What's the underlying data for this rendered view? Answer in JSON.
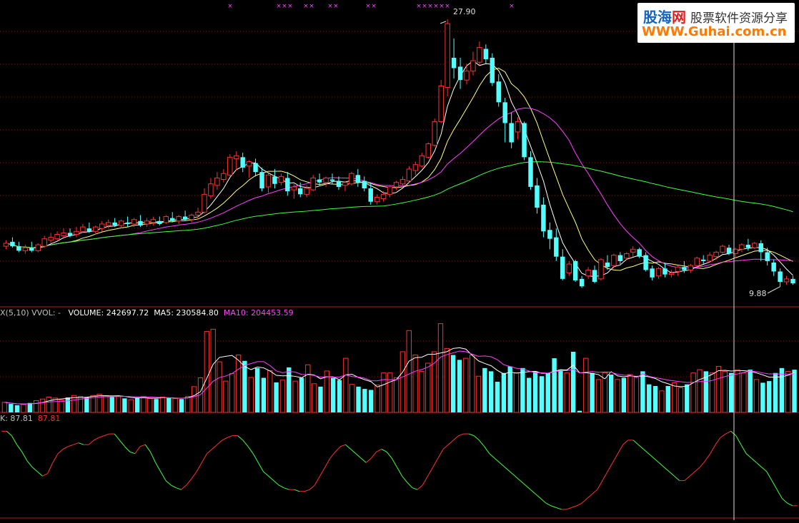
{
  "watermark": {
    "brand_a": "股海",
    "brand_b": "网",
    "tagline": "股票软件资源分享",
    "url": "WWW.Guhai.com.cn"
  },
  "price_panel": {
    "high_label": "27.90",
    "low_label": "9.88"
  },
  "volume_panel": {
    "legend": [
      {
        "text": "X(5,10)  VVOL: -",
        "color": "#c0c0c0"
      },
      {
        "text": "VOLUME: 242697.72",
        "color": "#ffffff"
      },
      {
        "text": "MA5: 230584.80",
        "color": "#ffffff"
      },
      {
        "text": "MA10: 204453.59",
        "color": "#ff40ff"
      }
    ]
  },
  "indicator_panel": {
    "legend": [
      {
        "text": "K: 87.81",
        "color": "#c0c0c0"
      },
      {
        "text": "87.81",
        "color": "#ff3030"
      }
    ]
  },
  "colors": {
    "up": "#ff3030",
    "down": "#54ffff",
    "ma5": "#ffffff",
    "ma10": "#ffff80",
    "ma20": "#ff40ff",
    "ma60": "#40ff40",
    "grid": "#7a1a1a"
  },
  "chart_data": [
    {
      "type": "candlestick",
      "title": "",
      "ylim": [
        9.0,
        29.0
      ],
      "markers": {
        "high": 27.9,
        "low": 9.88
      },
      "candles": [
        [
          12.6,
          13.0,
          12.8,
          12.4
        ],
        [
          12.9,
          13.2,
          12.6,
          12.5
        ],
        [
          12.6,
          12.9,
          12.3,
          12.2
        ],
        [
          12.3,
          12.7,
          12.5,
          12.1
        ],
        [
          12.5,
          12.9,
          12.3,
          12.2
        ],
        [
          12.3,
          12.8,
          12.7,
          12.2
        ],
        [
          12.6,
          13.3,
          13.1,
          12.5
        ],
        [
          13.0,
          13.5,
          13.2,
          12.8
        ],
        [
          13.1,
          13.6,
          13.4,
          13.0
        ],
        [
          13.3,
          13.8,
          13.5,
          13.1
        ],
        [
          13.5,
          13.8,
          13.3,
          13.2
        ],
        [
          13.4,
          13.9,
          13.6,
          13.2
        ],
        [
          13.6,
          14.1,
          13.9,
          13.5
        ],
        [
          13.8,
          14.2,
          13.6,
          13.5
        ],
        [
          13.6,
          14.0,
          13.9,
          13.4
        ],
        [
          13.8,
          14.3,
          14.1,
          13.6
        ],
        [
          14.0,
          14.4,
          14.2,
          13.8
        ],
        [
          14.2,
          14.5,
          14.0,
          13.9
        ],
        [
          14.0,
          14.4,
          14.3,
          13.8
        ],
        [
          14.2,
          14.6,
          14.1,
          13.9
        ],
        [
          14.1,
          14.5,
          14.4,
          13.9
        ],
        [
          14.3,
          14.7,
          14.0,
          13.9
        ],
        [
          14.1,
          14.5,
          14.3,
          13.9
        ],
        [
          14.2,
          14.6,
          14.4,
          14.0
        ],
        [
          14.3,
          14.6,
          14.1,
          14.0
        ],
        [
          14.2,
          14.7,
          14.6,
          14.1
        ],
        [
          14.5,
          14.9,
          14.3,
          14.2
        ],
        [
          14.3,
          14.7,
          14.6,
          14.1
        ],
        [
          14.6,
          15.0,
          14.4,
          14.3
        ],
        [
          14.4,
          14.8,
          14.7,
          14.2
        ],
        [
          14.7,
          15.2,
          14.9,
          14.4
        ],
        [
          14.9,
          16.5,
          16.1,
          14.8
        ],
        [
          16.0,
          17.2,
          16.8,
          15.8
        ],
        [
          16.7,
          17.6,
          17.2,
          16.4
        ],
        [
          17.1,
          17.8,
          17.5,
          16.9
        ],
        [
          17.4,
          18.8,
          18.6,
          17.3
        ],
        [
          18.5,
          19.0,
          18.7,
          17.7
        ],
        [
          18.6,
          18.9,
          17.9,
          17.6
        ],
        [
          18.0,
          18.4,
          18.3,
          17.2
        ],
        [
          18.2,
          18.5,
          17.6,
          17.3
        ],
        [
          17.6,
          17.9,
          16.5,
          16.3
        ],
        [
          16.6,
          17.5,
          17.4,
          16.2
        ],
        [
          17.3,
          17.8,
          16.8,
          16.5
        ],
        [
          16.9,
          17.5,
          17.3,
          16.7
        ],
        [
          17.2,
          17.6,
          16.3,
          16.0
        ],
        [
          16.4,
          16.8,
          16.6,
          15.8
        ],
        [
          16.5,
          16.9,
          16.1,
          15.9
        ],
        [
          16.1,
          16.7,
          16.5,
          15.9
        ],
        [
          16.4,
          17.4,
          17.2,
          16.3
        ],
        [
          17.1,
          17.5,
          16.9,
          16.7
        ],
        [
          16.9,
          17.3,
          17.2,
          16.6
        ],
        [
          17.1,
          17.5,
          17.0,
          16.8
        ],
        [
          17.0,
          17.3,
          16.6,
          16.4
        ],
        [
          16.7,
          17.0,
          16.9,
          16.3
        ],
        [
          16.8,
          17.6,
          17.5,
          16.7
        ],
        [
          17.4,
          17.8,
          16.9,
          16.6
        ],
        [
          17.0,
          17.3,
          16.5,
          16.3
        ],
        [
          16.5,
          16.9,
          15.6,
          15.4
        ],
        [
          15.6,
          16.1,
          15.9,
          15.4
        ],
        [
          15.8,
          16.3,
          16.1,
          15.6
        ],
        [
          16.1,
          16.7,
          16.6,
          15.9
        ],
        [
          16.6,
          17.0,
          16.9,
          16.4
        ],
        [
          16.8,
          17.3,
          17.1,
          16.6
        ],
        [
          17.0,
          18.0,
          17.8,
          16.9
        ],
        [
          17.7,
          18.3,
          18.1,
          17.4
        ],
        [
          18.0,
          18.9,
          18.7,
          17.9
        ],
        [
          18.6,
          19.6,
          19.5,
          18.5
        ],
        [
          19.4,
          21.2,
          21.0,
          19.3
        ],
        [
          21.0,
          23.8,
          23.4,
          20.9
        ],
        [
          23.3,
          27.9,
          27.6,
          22.7
        ],
        [
          25.3,
          26.6,
          24.6,
          23.9
        ],
        [
          24.7,
          25.3,
          23.8,
          23.2
        ],
        [
          23.8,
          24.9,
          24.4,
          23.5
        ],
        [
          24.4,
          25.7,
          25.1,
          24.1
        ],
        [
          25.0,
          26.4,
          26.0,
          24.8
        ],
        [
          25.9,
          26.2,
          25.2,
          24.9
        ],
        [
          25.3,
          25.6,
          23.6,
          23.4
        ],
        [
          23.7,
          24.2,
          22.3,
          22.0
        ],
        [
          22.3,
          22.6,
          20.9,
          19.6
        ],
        [
          20.9,
          21.6,
          19.6,
          19.2
        ],
        [
          20.3,
          21.3,
          21.0,
          19.8
        ],
        [
          20.9,
          21.0,
          18.6,
          18.4
        ],
        [
          18.6,
          19.0,
          16.6,
          16.4
        ],
        [
          16.7,
          17.2,
          15.2,
          14.8
        ],
        [
          15.4,
          15.9,
          13.6,
          13.2
        ],
        [
          13.7,
          14.2,
          13.1,
          12.4
        ],
        [
          13.2,
          13.8,
          11.9,
          11.6
        ],
        [
          11.9,
          12.4,
          10.4,
          10.3
        ],
        [
          10.8,
          11.6,
          11.4,
          10.6
        ],
        [
          11.6,
          11.7,
          10.3,
          10.2
        ],
        [
          10.4,
          10.6,
          9.9,
          9.8
        ],
        [
          10.6,
          11.2,
          11.0,
          10.4
        ],
        [
          11.0,
          11.3,
          10.2,
          10.1
        ],
        [
          10.4,
          11.8,
          11.7,
          10.3
        ],
        [
          11.5,
          12.0,
          11.2,
          11.0
        ],
        [
          11.3,
          12.1,
          12.0,
          11.1
        ],
        [
          12.0,
          12.2,
          11.6,
          11.4
        ],
        [
          11.8,
          12.2,
          12.1,
          11.7
        ],
        [
          12.2,
          12.6,
          12.4,
          11.9
        ],
        [
          12.4,
          12.5,
          11.9,
          11.8
        ],
        [
          12.0,
          12.2,
          11.0,
          10.9
        ],
        [
          11.1,
          11.3,
          10.5,
          10.3
        ],
        [
          10.6,
          11.2,
          11.1,
          10.4
        ],
        [
          11.1,
          11.5,
          10.7,
          10.5
        ],
        [
          10.7,
          11.0,
          10.8,
          10.5
        ],
        [
          10.9,
          11.3,
          11.2,
          10.6
        ],
        [
          11.2,
          11.6,
          11.0,
          10.8
        ],
        [
          11.0,
          11.4,
          11.3,
          10.8
        ],
        [
          11.3,
          11.9,
          11.8,
          11.2
        ],
        [
          11.7,
          12.0,
          11.6,
          11.4
        ],
        [
          11.6,
          12.2,
          12.0,
          11.5
        ],
        [
          11.9,
          12.3,
          12.2,
          11.7
        ],
        [
          12.2,
          12.7,
          12.6,
          12.1
        ],
        [
          12.5,
          12.7,
          12.1,
          12.0
        ],
        [
          12.1,
          12.5,
          12.4,
          11.8
        ],
        [
          12.4,
          12.8,
          12.7,
          12.2
        ],
        [
          12.7,
          13.1,
          12.5,
          12.3
        ],
        [
          12.5,
          12.9,
          12.8,
          12.4
        ],
        [
          12.8,
          13.0,
          12.2,
          11.6
        ],
        [
          12.2,
          12.5,
          11.6,
          11.3
        ],
        [
          11.5,
          11.7,
          10.9,
          10.6
        ],
        [
          10.9,
          11.1,
          10.2,
          9.88
        ],
        [
          10.2,
          10.6,
          10.4,
          10.0
        ],
        [
          10.4,
          10.6,
          10.1,
          10.0
        ]
      ]
    },
    {
      "type": "bar",
      "title": "",
      "series_name": "VOLUME",
      "ylim": [
        0,
        280000
      ],
      "values": [
        31000,
        26000,
        22000,
        24000,
        29000,
        36000,
        41000,
        47000,
        44000,
        38000,
        46000,
        52000,
        49000,
        47000,
        52000,
        56000,
        51000,
        47000,
        49000,
        43000,
        39000,
        45000,
        49000,
        43000,
        41000,
        47000,
        45000,
        43000,
        41000,
        49000,
        79000,
        106000,
        248000,
        255000,
        155000,
        96000,
        119000,
        176000,
        158000,
        107000,
        136000,
        106000,
        128000,
        92000,
        99000,
        138000,
        96000,
        106000,
        146000,
        88000,
        79000,
        127000,
        106000,
        99000,
        166000,
        86000,
        79000,
        72000,
        69000,
        84000,
        121000,
        121000,
        106000,
        186000,
        251000,
        176000,
        126000,
        151000,
        186000,
        272000,
        196000,
        176000,
        161000,
        166000,
        176000,
        111000,
        136000,
        126000,
        94000,
        121000,
        141000,
        121000,
        136000,
        106000,
        126000,
        111000,
        121000,
        166000,
        131000,
        121000,
        186000,
        5000,
        166000,
        121000,
        101000,
        121000,
        116000,
        101000,
        106000,
        116000,
        111000,
        126000,
        86000,
        81000,
        66000,
        81000,
        91000,
        76000,
        86000,
        121000,
        131000,
        126000,
        121000,
        141000,
        126000,
        121000,
        131000,
        121000,
        131000,
        101000,
        91000,
        96000,
        121000,
        136000,
        126000,
        131000
      ]
    },
    {
      "type": "line",
      "title": "",
      "series_name": "K",
      "ylim": [
        0,
        100
      ],
      "values": [
        95,
        95,
        90,
        80,
        72,
        62,
        55,
        50,
        45,
        48,
        60,
        70,
        75,
        78,
        80,
        82,
        80,
        80,
        85,
        88,
        90,
        92,
        92,
        85,
        78,
        72,
        70,
        78,
        80,
        72,
        60,
        50,
        40,
        35,
        32,
        30,
        35,
        42,
        50,
        60,
        70,
        75,
        80,
        85,
        88,
        90,
        90,
        85,
        78,
        70,
        60,
        50,
        45,
        40,
        35,
        32,
        30,
        30,
        28,
        28,
        30,
        35,
        45,
        55,
        65,
        72,
        78,
        80,
        75,
        70,
        65,
        60,
        65,
        72,
        75,
        72,
        65,
        55,
        45,
        38,
        32,
        30,
        35,
        45,
        55,
        65,
        75,
        80,
        85,
        90,
        92,
        92,
        90,
        85,
        78,
        70,
        65,
        60,
        55,
        50,
        45,
        40,
        35,
        30,
        25,
        20,
        15,
        12,
        10,
        8,
        8,
        10,
        12,
        15,
        20,
        25,
        30,
        40,
        50,
        60,
        70,
        80,
        85,
        85,
        80,
        75,
        70,
        65,
        60,
        55,
        50,
        45,
        40,
        40,
        45,
        50,
        55,
        62,
        70,
        80,
        88,
        92,
        95,
        90,
        80,
        70,
        65,
        60,
        55,
        50,
        40,
        30,
        20,
        15,
        12,
        12
      ]
    }
  ]
}
